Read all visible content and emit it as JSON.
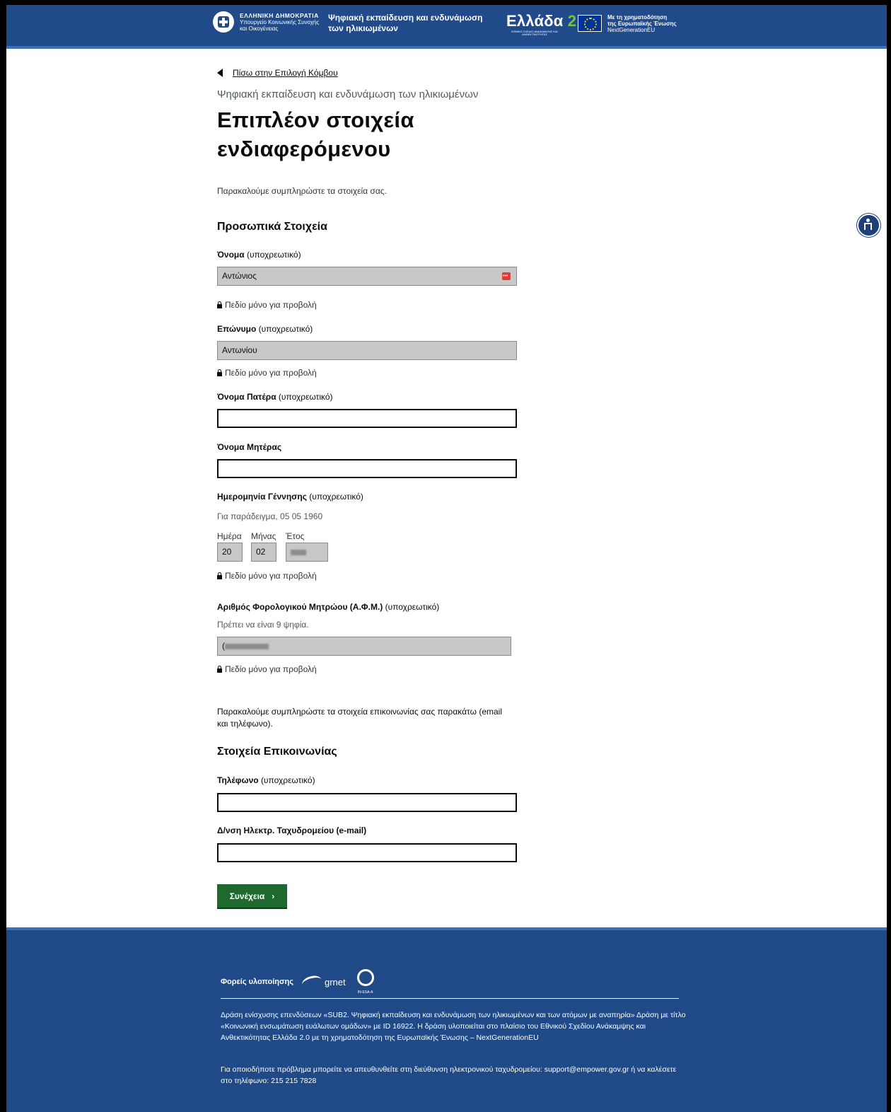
{
  "header": {
    "gov_line1": "ΕΛΛΗΝΙΚΗ ΔΗΜΟΚΡΑΤΙΑ",
    "gov_line2": "Υπουργείο Κοινωνικής Συνοχής",
    "gov_line3": "και Οικογένειας",
    "service_title": "Ψηφιακή εκπαίδευση και ενδυνάμωση των ηλικιωμένων",
    "el20_main": "Ελλάδα",
    "el20_ver": "2.0",
    "el20_sub": "ΕΘΝΙΚΟ ΣΧΕΔΙΟ ΑΝΑΚΑΜΨΗΣ ΚΑΙ ΑΝΘΕΚΤΙΚΟΤΗΤΑΣ",
    "eu_line1": "Με τη χρηματοδότηση",
    "eu_line2": "της Ευρωπαϊκής Ένωσης",
    "eu_line3": "NextGenerationEU"
  },
  "back_link": "Πίσω στην Επιλογή Κόμβου",
  "caption": "Ψηφιακή εκπαίδευση και ενδυνάμωση των ηλικιωμένων",
  "page_title": "Επιπλέον στοιχεία ενδιαφερόμενου",
  "intro": "Παρακαλούμε συμπληρώστε τα στοιχεία σας.",
  "personal": {
    "heading": "Προσωπικά Στοιχεία",
    "required": "(υποχρεωτικό)",
    "readonly_note": "Πεδίο μόνο για προβολή",
    "first_name_label": "Όνομα",
    "first_name_value": "Αντώνιος",
    "last_name_label": "Επώνυμο",
    "last_name_value": "Αντωνίου",
    "father_label": "Όνομα Πατέρα",
    "father_value": "",
    "mother_label": "Όνομα Μητέρας",
    "mother_value": "",
    "dob_label": "Ημερομηνία Γέννησης",
    "dob_hint": "Για παράδειγμα, 05 05 1960",
    "day_label": "Ημέρα",
    "month_label": "Μήνας",
    "year_label": "Έτος",
    "day_value": "20",
    "month_value": "02",
    "afm_label": "Αριθμός Φορολογικού Μητρώου (Α.Φ.Μ.)",
    "afm_hint": "Πρέπει να είναι 9 ψηφία.",
    "afm_prefix": "("
  },
  "contact_intro": "Παρακαλούμε συμπληρώστε τα στοιχεία επικοινωνίας σας παρακάτω (email και τηλέφωνο).",
  "contact": {
    "heading": "Στοιχεία Επικοινωνίας",
    "phone_label": "Τηλέφωνο",
    "phone_value": "",
    "email_label": "Δ/νση Ηλεκτρ. Ταχυδρομείου (e-mail)",
    "email_value": ""
  },
  "continue_button": "Συνέχεια",
  "continue_chevron": "›",
  "footer": {
    "partners_label": "Φορείς υλοποίησης",
    "grnet": "grnet",
    "inesa": "IN-ESA-A",
    "text1": "Δράση ενίσχυσης επενδύσεων «SUB2. Ψηφιακή εκπαίδευση και ενδυνάμωση των ηλικιωμένων και των ατόμων με αναπηρία» Δράση με τίτλο «Κοινωνική ενσωμάτωση ευάλωτων ομάδων» με ID 16922. Η δράση υλοποιείται στο πλαίσιο του Εθνικού Σχεδίου Ανάκαμψης και Ανθεκτικότητας Ελλάδα 2.0 με τη χρηματοδότηση της Ευρωπαϊκής Ένωσης – NextGenerationEU",
    "text2": "Για οποιοδήποτε πρόβλημα μπορείτε να απευθυνθείτε στη διεύθυνση ηλεκτρονικού ταχυδρομείου: support@empower.gov.gr ή να καλέσετε στο τηλέφωνο: 215 215 7828"
  },
  "icons": {
    "back": "triangle-left-icon",
    "lock": "lock-icon",
    "accessibility": "accessibility-icon",
    "password_manager": "password-manager-icon"
  },
  "colors": {
    "header_bg": "#204a8a",
    "button_bg": "#1e6a2e",
    "readonly_bg": "#c8c8c8"
  }
}
